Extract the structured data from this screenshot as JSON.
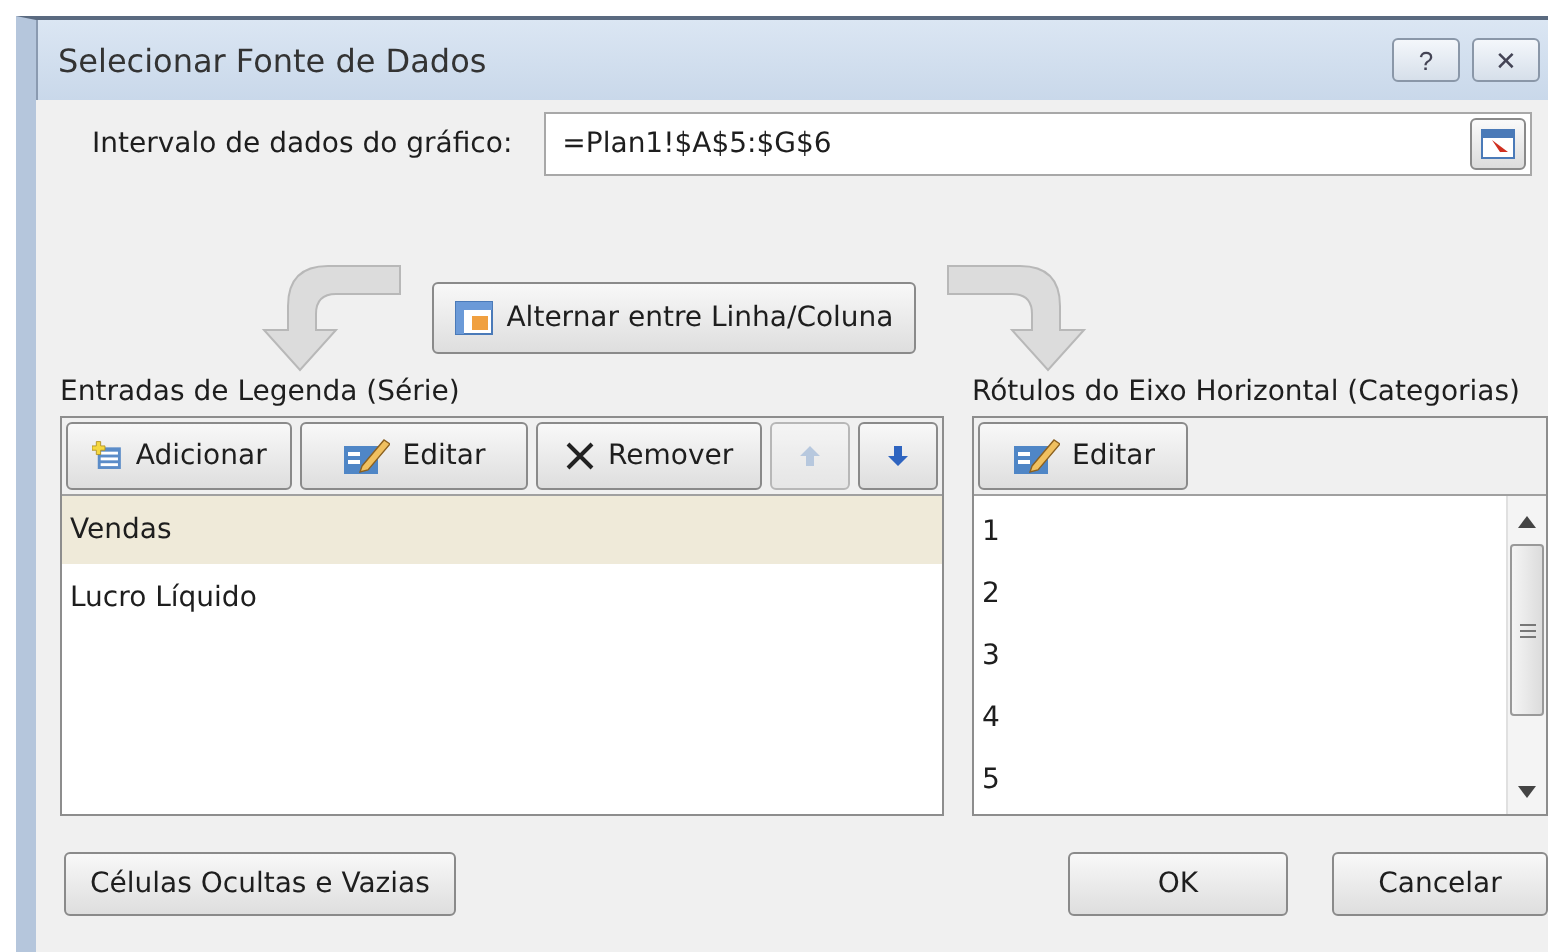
{
  "window": {
    "title": "Selecionar Fonte de Dados",
    "help": "?",
    "close": "✕"
  },
  "range": {
    "label": "Intervalo de dados do gráfico:",
    "value": "=Plan1!$A$5:$G$6"
  },
  "switch_button": "Alternar entre Linha/Coluna",
  "legend": {
    "title": "Entradas de Legenda (Série)",
    "buttons": [
      {
        "kind": "add",
        "label": "Adicionar",
        "disabled": false
      },
      {
        "kind": "edit",
        "label": "Editar",
        "disabled": false
      },
      {
        "kind": "remove",
        "label": "Remover",
        "disabled": false
      },
      {
        "kind": "up",
        "disabled": true
      },
      {
        "kind": "down",
        "disabled": false
      }
    ],
    "items": [
      {
        "label": "Vendas",
        "selected": true
      },
      {
        "label": "Lucro Líquido",
        "selected": false
      }
    ]
  },
  "categories": {
    "title": "Rótulos do Eixo Horizontal (Categorias)",
    "buttons": [
      {
        "kind": "edit",
        "label": "Editar",
        "disabled": false
      }
    ],
    "items": [
      {
        "label": "1"
      },
      {
        "label": "2"
      },
      {
        "label": "3"
      },
      {
        "label": "4"
      },
      {
        "label": "5"
      }
    ]
  },
  "footer": {
    "hidden_cells": "Células Ocultas e Vazias",
    "ok": "OK",
    "cancel": "Cancelar"
  }
}
